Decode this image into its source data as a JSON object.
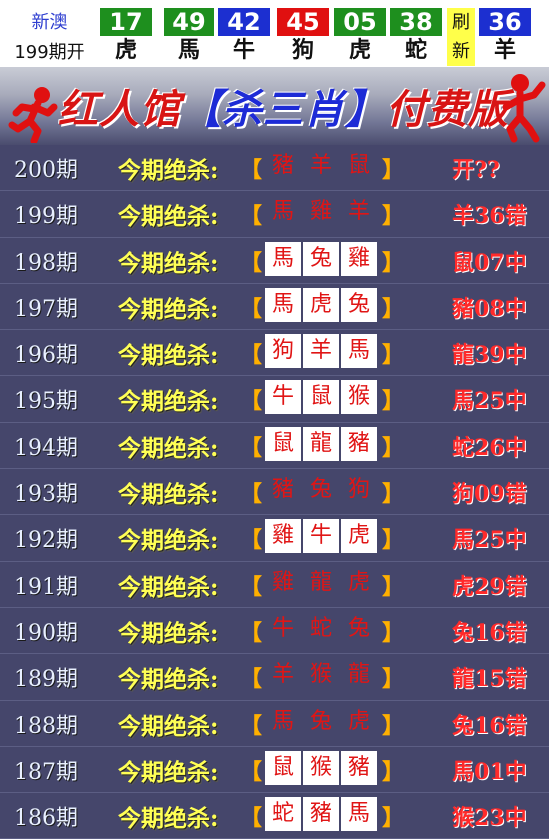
{
  "header": {
    "region": "新澳",
    "period": "199期开",
    "balls": [
      {
        "num": "17",
        "zodiac": "虎",
        "color": "green"
      },
      {
        "num": "49",
        "zodiac": "馬",
        "color": "green"
      },
      {
        "num": "42",
        "zodiac": "牛",
        "color": "blue"
      },
      {
        "num": "45",
        "zodiac": "狗",
        "color": "red"
      },
      {
        "num": "05",
        "zodiac": "虎",
        "color": "green"
      },
      {
        "num": "38",
        "zodiac": "蛇",
        "color": "green"
      }
    ],
    "refresh_label": "刷新",
    "special": {
      "num": "36",
      "zodiac": "羊",
      "color": "blue"
    }
  },
  "banner": {
    "title_a": "红人馆",
    "title_b": "【杀三肖】",
    "title_c": "付费版"
  },
  "prompt_label": "今期绝杀:",
  "bracket_left": "【",
  "bracket_right": "】",
  "rows": [
    {
      "period": "200期",
      "zodiacs": [
        "豬",
        "羊",
        "鼠"
      ],
      "boxed": false,
      "result": "开??"
    },
    {
      "period": "199期",
      "zodiacs": [
        "馬",
        "雞",
        "羊"
      ],
      "boxed": false,
      "result": "羊36错"
    },
    {
      "period": "198期",
      "zodiacs": [
        "馬",
        "兔",
        "雞"
      ],
      "boxed": true,
      "result": "鼠07中"
    },
    {
      "period": "197期",
      "zodiacs": [
        "馬",
        "虎",
        "兔"
      ],
      "boxed": true,
      "result": "豬08中"
    },
    {
      "period": "196期",
      "zodiacs": [
        "狗",
        "羊",
        "馬"
      ],
      "boxed": true,
      "result": "龍39中"
    },
    {
      "period": "195期",
      "zodiacs": [
        "牛",
        "鼠",
        "猴"
      ],
      "boxed": true,
      "result": "馬25中"
    },
    {
      "period": "194期",
      "zodiacs": [
        "鼠",
        "龍",
        "豬"
      ],
      "boxed": true,
      "result": "蛇26中"
    },
    {
      "period": "193期",
      "zodiacs": [
        "豬",
        "兔",
        "狗"
      ],
      "boxed": false,
      "result": "狗09错"
    },
    {
      "period": "192期",
      "zodiacs": [
        "雞",
        "牛",
        "虎"
      ],
      "boxed": true,
      "result": "馬25中"
    },
    {
      "period": "191期",
      "zodiacs": [
        "雞",
        "龍",
        "虎"
      ],
      "boxed": false,
      "result": "虎29错"
    },
    {
      "period": "190期",
      "zodiacs": [
        "牛",
        "蛇",
        "兔"
      ],
      "boxed": false,
      "result": "兔16错"
    },
    {
      "period": "189期",
      "zodiacs": [
        "羊",
        "猴",
        "龍"
      ],
      "boxed": false,
      "result": "龍15错"
    },
    {
      "period": "188期",
      "zodiacs": [
        "馬",
        "兔",
        "虎"
      ],
      "boxed": false,
      "result": "兔16错"
    },
    {
      "period": "187期",
      "zodiacs": [
        "鼠",
        "猴",
        "豬"
      ],
      "boxed": true,
      "result": "馬01中"
    },
    {
      "period": "186期",
      "zodiacs": [
        "蛇",
        "豬",
        "馬"
      ],
      "boxed": true,
      "result": "猴23中"
    }
  ]
}
